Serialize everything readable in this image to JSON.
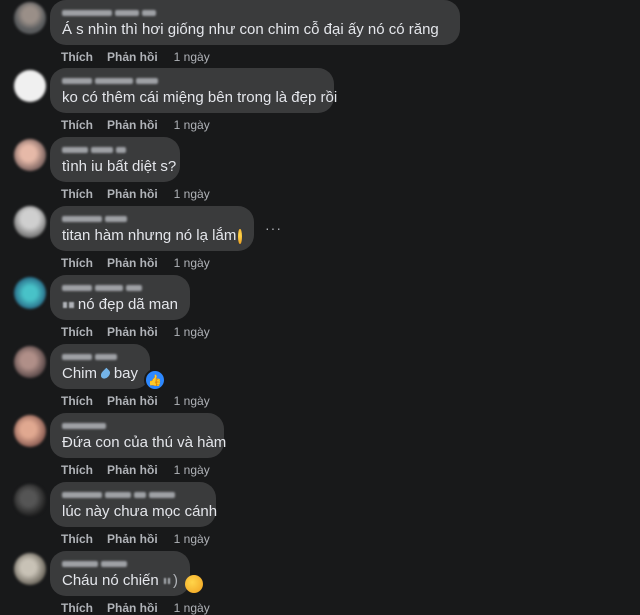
{
  "actions": {
    "like_label": "Thích",
    "reply_label": "Phản hồi"
  },
  "comments": [
    {
      "text": "Á s nhìn thì hơi giống như con chim cỗ đại ấy nó có răng",
      "time": "1 ngày",
      "emojis": [
        "rofl-emoji-icon",
        "droplet-icon"
      ]
    },
    {
      "text": "ko có thêm cái miệng bên trong là đẹp rồi",
      "time": "1 ngày"
    },
    {
      "text": "tình iu bất diệt s?",
      "time": "1 ngày"
    },
    {
      "text": "titan hàm nhưng nó lạ lắm",
      "time": "1 ngày",
      "emojis": [
        "sweat-smile-emoji-icon"
      ]
    },
    {
      "text": "nó đẹp dã man",
      "time": "1 ngày"
    },
    {
      "text_a": "Chim",
      "text_b": "bay",
      "time": "1 ngày",
      "reaction": "like-icon"
    },
    {
      "text": "Đứa con của thú và hàm",
      "time": "1 ngày"
    },
    {
      "text": "lúc này chưa mọc cánh",
      "time": "1 ngày"
    },
    {
      "text": "Cháu nó chiến",
      "time": "1 ngày",
      "emojis": [
        "blush-emoji-icon"
      ]
    }
  ],
  "more_options": "···",
  "colors": {
    "background": "#18191a",
    "bubble": "#3a3b3c",
    "text": "#e4e6eb",
    "secondary": "#b0b3b8",
    "like_blue": "#2d88ff"
  }
}
